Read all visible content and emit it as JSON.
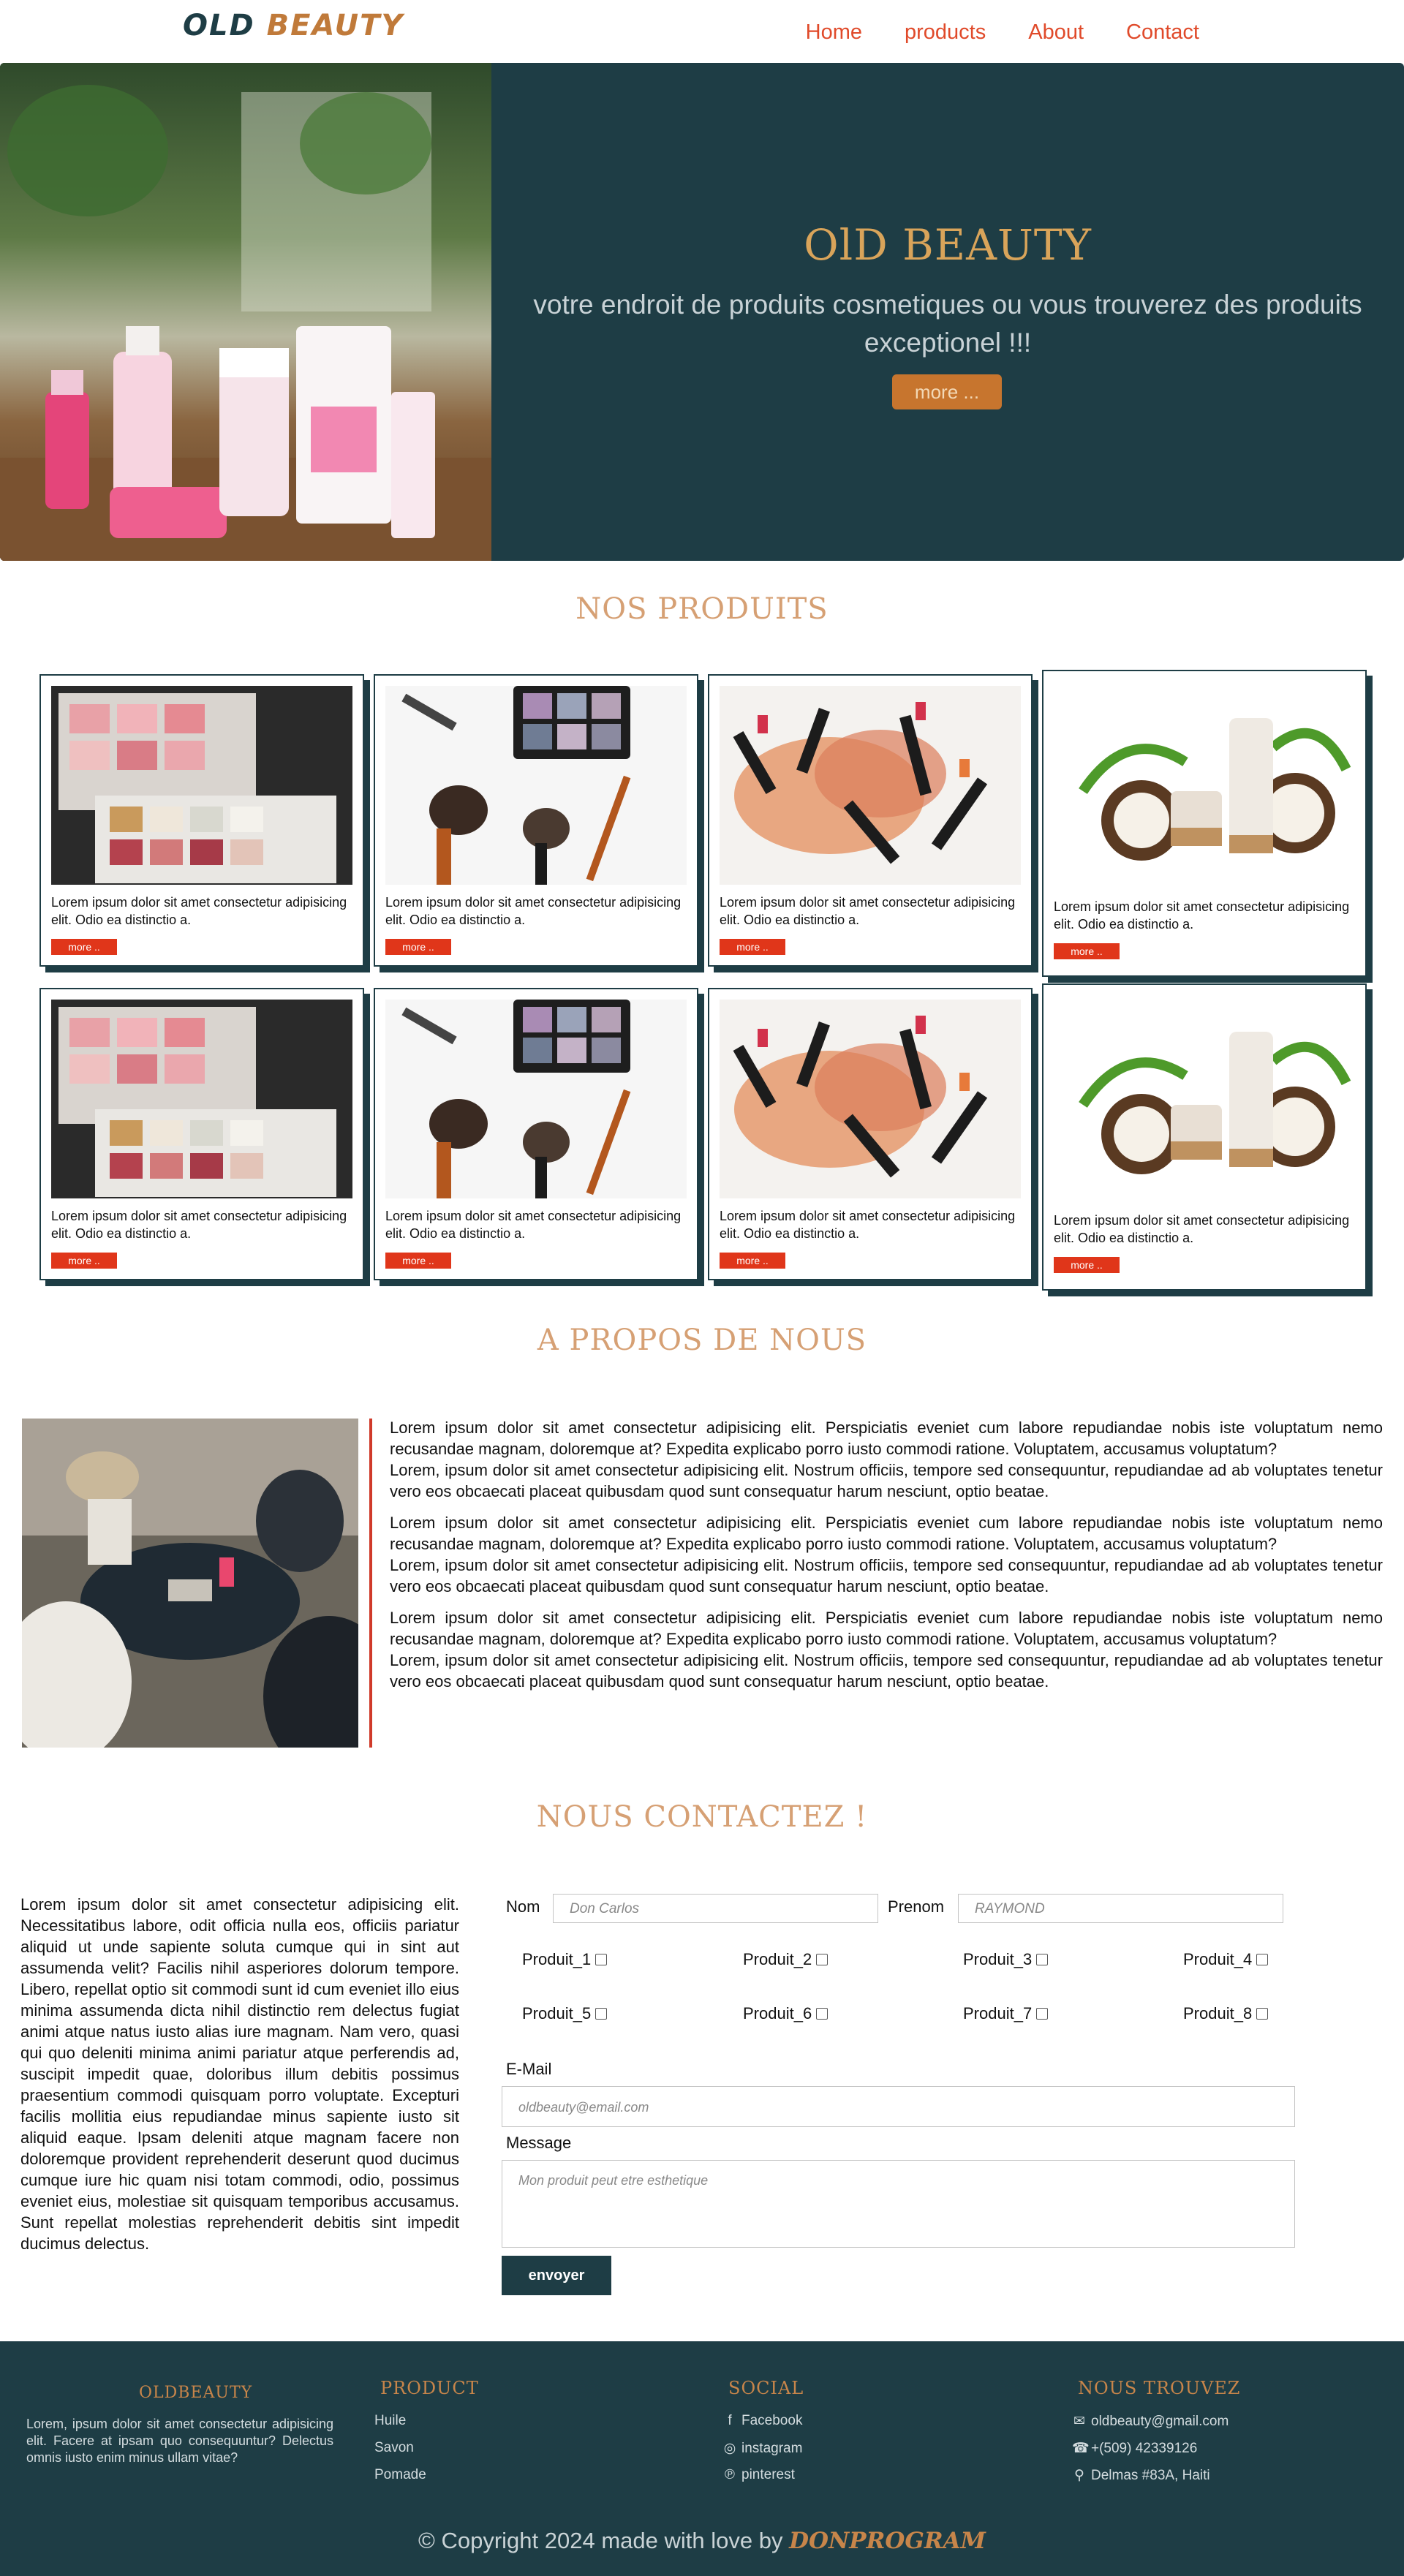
{
  "nav": {
    "logo_part1": "OLD",
    "logo_part2": "BEAUTY",
    "links": [
      "Home",
      "products",
      "About",
      "Contact"
    ]
  },
  "hero": {
    "title": "OlD BEAUTY",
    "subtitle": "votre endroit de produits cosmetiques ou vous trouverez des produits exceptionel !!!",
    "button": "more ..."
  },
  "products": {
    "title": "NOS PRODUITS",
    "cards": [
      {
        "text": "Lorem ipsum dolor sit amet consectetur adipisicing elit. Odio ea distinctio a.",
        "button": "more ..",
        "image": "eyeshadow-palette"
      },
      {
        "text": "Lorem ipsum dolor sit amet consectetur adipisicing elit. Odio ea distinctio a.",
        "button": "more ..",
        "image": "makeup-brushes"
      },
      {
        "text": "Lorem ipsum dolor sit amet consectetur adipisicing elit. Odio ea distinctio a.",
        "button": "more ..",
        "image": "lipsticks"
      },
      {
        "text": "Lorem ipsum dolor sit amet consectetur adipisicing elit. Odio ea distinctio a.",
        "button": "more ..",
        "image": "coconut-cream"
      },
      {
        "text": "Lorem ipsum dolor sit amet consectetur adipisicing elit. Odio ea distinctio a.",
        "button": "more ..",
        "image": "eyeshadow-palette"
      },
      {
        "text": "Lorem ipsum dolor sit amet consectetur adipisicing elit. Odio ea distinctio a.",
        "button": "more ..",
        "image": "makeup-brushes"
      },
      {
        "text": "Lorem ipsum dolor sit amet consectetur adipisicing elit. Odio ea distinctio a.",
        "button": "more ..",
        "image": "lipsticks"
      },
      {
        "text": "Lorem ipsum dolor sit amet consectetur adipisicing elit. Odio ea distinctio a.",
        "button": "more ..",
        "image": "coconut-cream"
      }
    ]
  },
  "about": {
    "title": "A PROPOS DE NOUS",
    "paragraphs": [
      "Lorem ipsum dolor sit amet consectetur adipisicing elit. Perspiciatis eveniet cum labore repudiandae nobis iste voluptatum nemo recusandae magnam, doloremque at? Expedita explicabo porro iusto commodi ratione. Voluptatem, accusamus voluptatum?",
      "Lorem, ipsum dolor sit amet consectetur adipisicing elit. Nostrum officiis, tempore sed consequuntur, repudiandae ad ab voluptates tenetur vero eos obcaecati placeat quibusdam quod sunt consequatur harum nesciunt, optio beatae.",
      "Lorem ipsum dolor sit amet consectetur adipisicing elit. Perspiciatis eveniet cum labore repudiandae nobis iste voluptatum nemo recusandae magnam, doloremque at? Expedita explicabo porro iusto commodi ratione. Voluptatem, accusamus voluptatum?",
      "Lorem, ipsum dolor sit amet consectetur adipisicing elit. Nostrum officiis, tempore sed consequuntur, repudiandae ad ab voluptates tenetur vero eos obcaecati placeat quibusdam quod sunt consequatur harum nesciunt, optio beatae.",
      "Lorem ipsum dolor sit amet consectetur adipisicing elit. Perspiciatis eveniet cum labore repudiandae nobis iste voluptatum nemo recusandae magnam, doloremque at? Expedita explicabo porro iusto commodi ratione. Voluptatem, accusamus voluptatum?",
      "Lorem, ipsum dolor sit amet consectetur adipisicing elit. Nostrum officiis, tempore sed consequuntur, repudiandae ad ab voluptates tenetur vero eos obcaecati placeat quibusdam quod sunt consequatur harum nesciunt, optio beatae."
    ]
  },
  "contact": {
    "title": "NOUS CONTACTEZ !",
    "intro": "Lorem ipsum dolor sit amet consectetur adipisicing elit. Necessitatibus labore, odit officia nulla eos, officiis pariatur aliquid ut unde sapiente soluta cumque qui in sint aut assumenda velit? Facilis nihil asperiores dolorum tempore. Libero, repellat optio sit commodi sunt id cum eveniet illo eius minima assumenda dicta nihil distinctio rem delectus fugiat animi atque natus iusto alias iure magnam. Nam vero, quasi qui quo deleniti minima animi pariatur atque perferendis ad, suscipit impedit quae, doloribus illum debitis possimus praesentium commodi quisquam porro voluptate. Excepturi facilis mollitia eius repudiandae minus sapiente iusto sit aliquid eaque. Ipsam deleniti atque magnam facere non doloremque provident reprehenderit deserunt quod ducimus cumque iure hic quam nisi totam commodi, odio, possimus eveniet eius, molestiae sit quisquam temporibus accusamus. Sunt repellat molestias reprehenderit debitis sint impedit ducimus delectus.",
    "nom_label": "Nom",
    "nom_placeholder": "Don Carlos",
    "prenom_label": "Prenom",
    "prenom_placeholder": "RAYMOND",
    "checkboxes": [
      "Produit_1",
      "Produit_2",
      "Produit_3",
      "Produit_4",
      "Produit_5",
      "Produit_6",
      "Produit_7",
      "Produit_8"
    ],
    "email_label": "E-Mail",
    "email_placeholder": "oldbeauty@email.com",
    "message_label": "Message",
    "message_placeholder": "Mon produit peut etre esthetique",
    "submit": "envoyer"
  },
  "footer": {
    "col1_title": "OLDBEAUTY",
    "col1_text": "Lorem, ipsum dolor sit amet consectetur adipisicing elit. Facere at ipsam quo consequuntur? Delectus omnis iusto enim minus ullam vitae?",
    "col2_title": "PRODUCT",
    "col2_items": [
      "Huile",
      "Savon",
      "Pomade"
    ],
    "col3_title": "SOCIAL",
    "col3_items": [
      {
        "icon": "facebook-icon",
        "label": "Facebook"
      },
      {
        "icon": "instagram-icon",
        "label": "instagram"
      },
      {
        "icon": "pinterest-icon",
        "label": "pinterest"
      }
    ],
    "col4_title": "NOUS TROUVEZ",
    "col4_items": [
      {
        "icon": "envelope-icon",
        "label": "oldbeauty@gmail.com"
      },
      {
        "icon": "phone-icon",
        "label": "+(509) 42339126"
      },
      {
        "icon": "map-marker-icon",
        "label": "Delmas #83A, Haiti"
      }
    ],
    "copyright_prefix": "© Copyright 2024 made with love by",
    "copyright_brand": "DONPROGRAM"
  },
  "colors": {
    "primary_dark": "#1e3d45",
    "accent_orange": "#c7752e",
    "link_red": "#e04a2a",
    "button_red": "#e0361a",
    "title_tan": "#d6a074"
  }
}
